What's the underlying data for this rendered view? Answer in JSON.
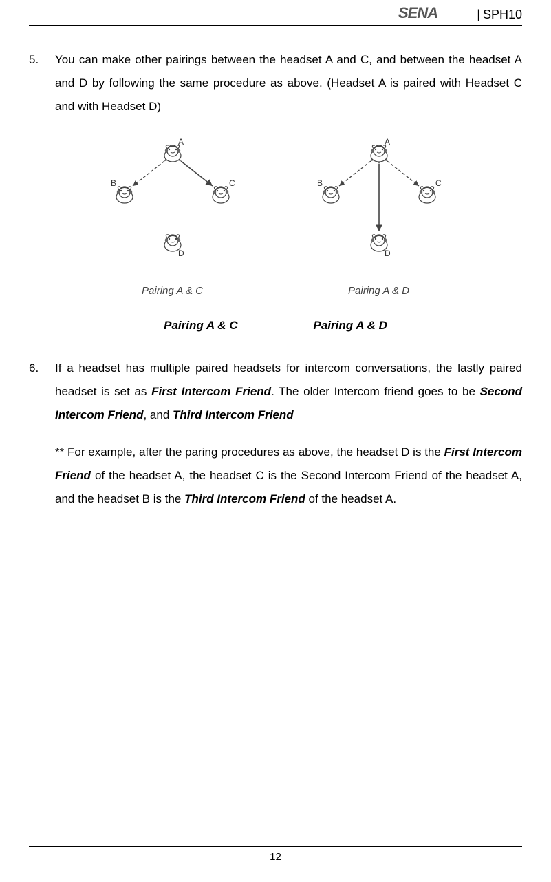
{
  "header": {
    "brand": "SENA",
    "separator": "|",
    "model": "SPH10"
  },
  "items": [
    {
      "num": "5.",
      "text": "You can make other pairings between the headset A and C, and between the headset A and D by following the same procedure as above. (Headset A is paired with Headset C and with Headset D)"
    },
    {
      "num": "6.",
      "parts": {
        "p1": "If a headset has multiple paired headsets for intercom conversations, the lastly paired headset is set as ",
        "b1": "First Intercom Friend",
        "p2": ". The older Intercom friend goes to be ",
        "b2": "Second Intercom Friend",
        "p3": ", and ",
        "b3": "Third Intercom Friend"
      }
    }
  ],
  "diagrams": {
    "left_sub": "Pairing A & C",
    "right_sub": "Pairing A & D",
    "left_caption": "Pairing A & C",
    "right_caption": "Pairing A & D",
    "nodes": {
      "a": "A",
      "b": "B",
      "c": "C",
      "d": "D"
    }
  },
  "example": {
    "p1": "** For example, after the paring procedures as above, the headset D is the ",
    "b1": "First Intercom Friend",
    "p2": " of the headset A, the headset C is the Second Intercom Friend of the headset A, and the headset B is the ",
    "b2": "Third Intercom Friend",
    "p3": " of the headset A."
  },
  "footer": {
    "page": "12"
  }
}
